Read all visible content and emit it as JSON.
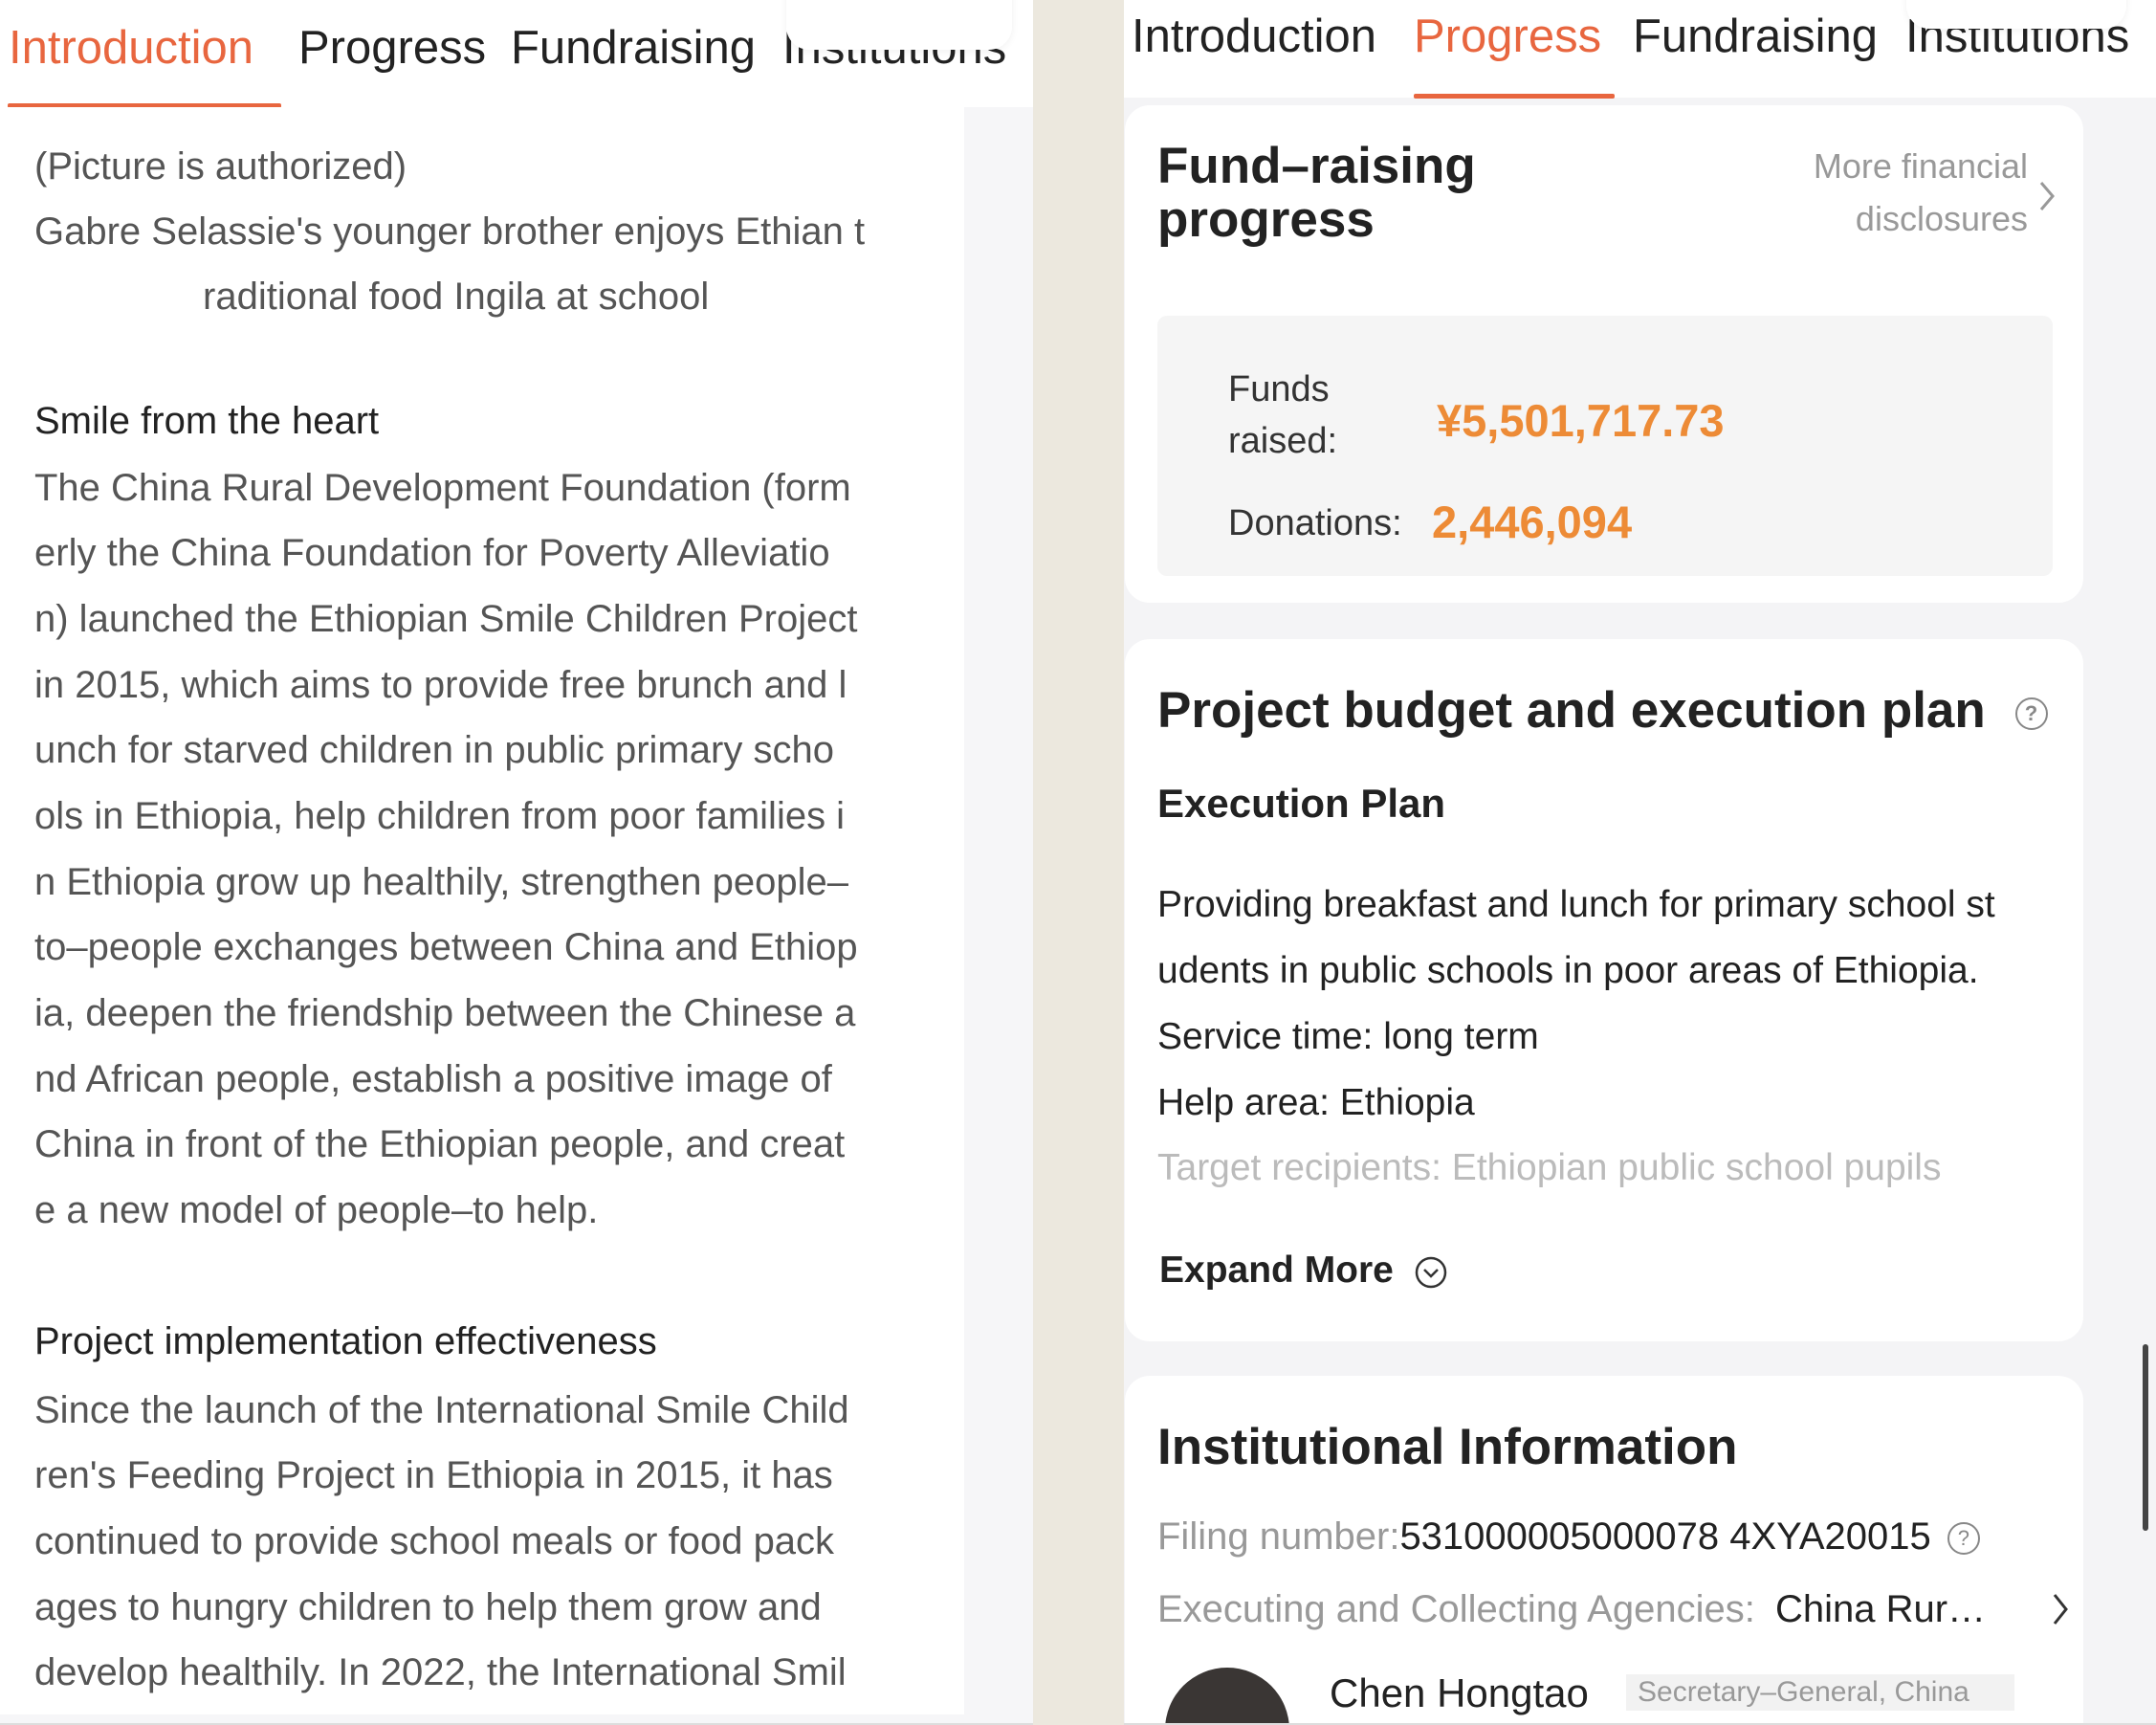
{
  "tabs": [
    "Introduction",
    "Progress",
    "Fundraising",
    "Institutions"
  ],
  "left": {
    "active_tab": "Introduction",
    "caption": [
      "(Picture is authorized)",
      "Gabre Selassie's younger brother enjoys Ethian t",
      "raditional food Ingila at school"
    ],
    "section1": {
      "heading": "Smile from the heart",
      "lines": [
        "The China Rural Development Foundation (form",
        "erly the China Foundation for Poverty Alleviatio",
        "n) launched the Ethiopian Smile Children Project",
        "in 2015, which aims to provide free brunch and l",
        "unch for starved children in public primary scho",
        "ols in Ethiopia, help children from poor families i",
        "n Ethiopia grow up healthily, strengthen people–",
        "to–people exchanges between China and Ethiop",
        "ia, deepen the friendship between the Chinese a",
        "nd African people, establish a positive image of",
        "China in front of the Ethiopian people, and creat",
        "e a new model of people–to help."
      ]
    },
    "section2": {
      "heading": "Project implementation effectiveness",
      "lines": [
        "Since the launch of the International Smile Child",
        "ren's Feeding Project in Ethiopia in 2015, it has",
        "continued to provide school meals or food pack",
        "ages to hungry children to help them grow and",
        "develop healthily. In 2022, the International Smil"
      ]
    }
  },
  "right": {
    "active_tab": "Progress",
    "fundraising": {
      "title_line1": "Fund–raising",
      "title_line2": "progress",
      "more_line1": "More financial",
      "more_line2": "disclosures",
      "funds_label_line1": "Funds",
      "funds_label_line2": "raised:",
      "funds_value": "¥5,501,717.73",
      "donations_label": "Donations:",
      "donations_value": "2,446,094"
    },
    "budget": {
      "title": "Project budget and execution plan",
      "subtitle": "Execution Plan",
      "lines": [
        "Providing breakfast and lunch for primary school st",
        "udents in public schools in poor areas of Ethiopia.",
        "Service time: long term",
        "Help area: Ethiopia"
      ],
      "faded_line": "Target recipients: Ethiopian public school pupils",
      "expand": "Expand More"
    },
    "institution": {
      "title": "Institutional Information",
      "filing_label": "Filing number:",
      "filing_value": "531000005000078 4XYA20015",
      "agency_label": "Executing and Collecting Agencies:",
      "agency_value": "China Rur…",
      "person_name": "Chen Hongtao",
      "person_title": "Secretary–General, China"
    }
  }
}
